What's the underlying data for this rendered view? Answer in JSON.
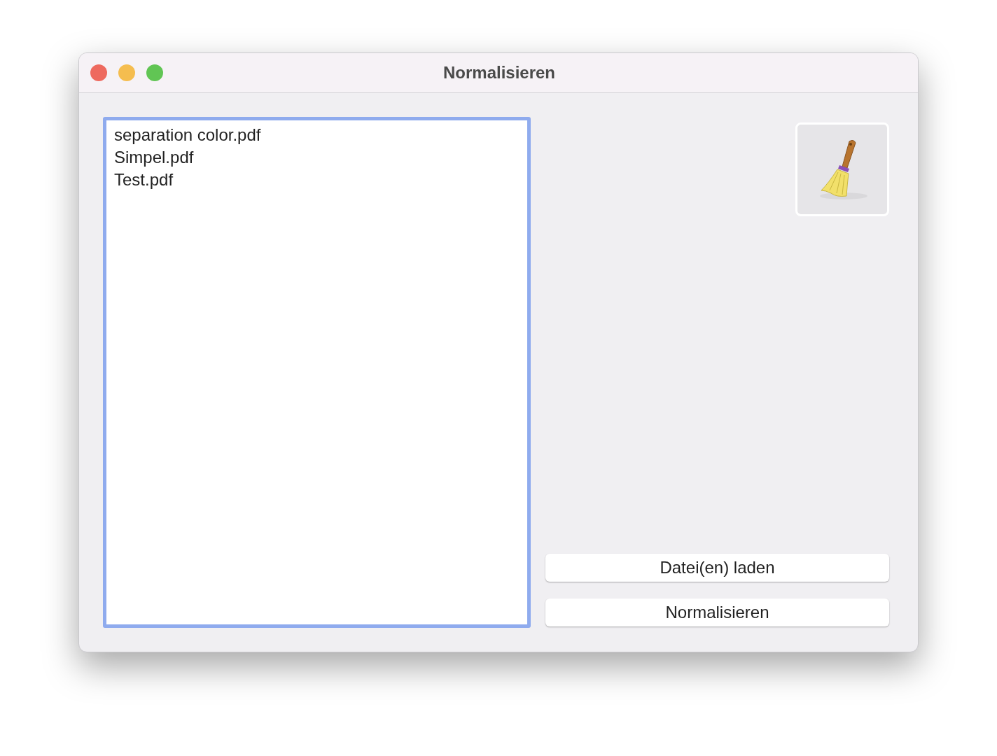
{
  "window": {
    "title": "Normalisieren"
  },
  "file_list": {
    "focused": true,
    "items": [
      {
        "label": "separation color.pdf"
      },
      {
        "label": "Simpel.pdf"
      },
      {
        "label": "Test.pdf"
      }
    ]
  },
  "buttons": [
    {
      "label": "Datei(en) laden"
    },
    {
      "label": "Normalisieren"
    }
  ]
}
